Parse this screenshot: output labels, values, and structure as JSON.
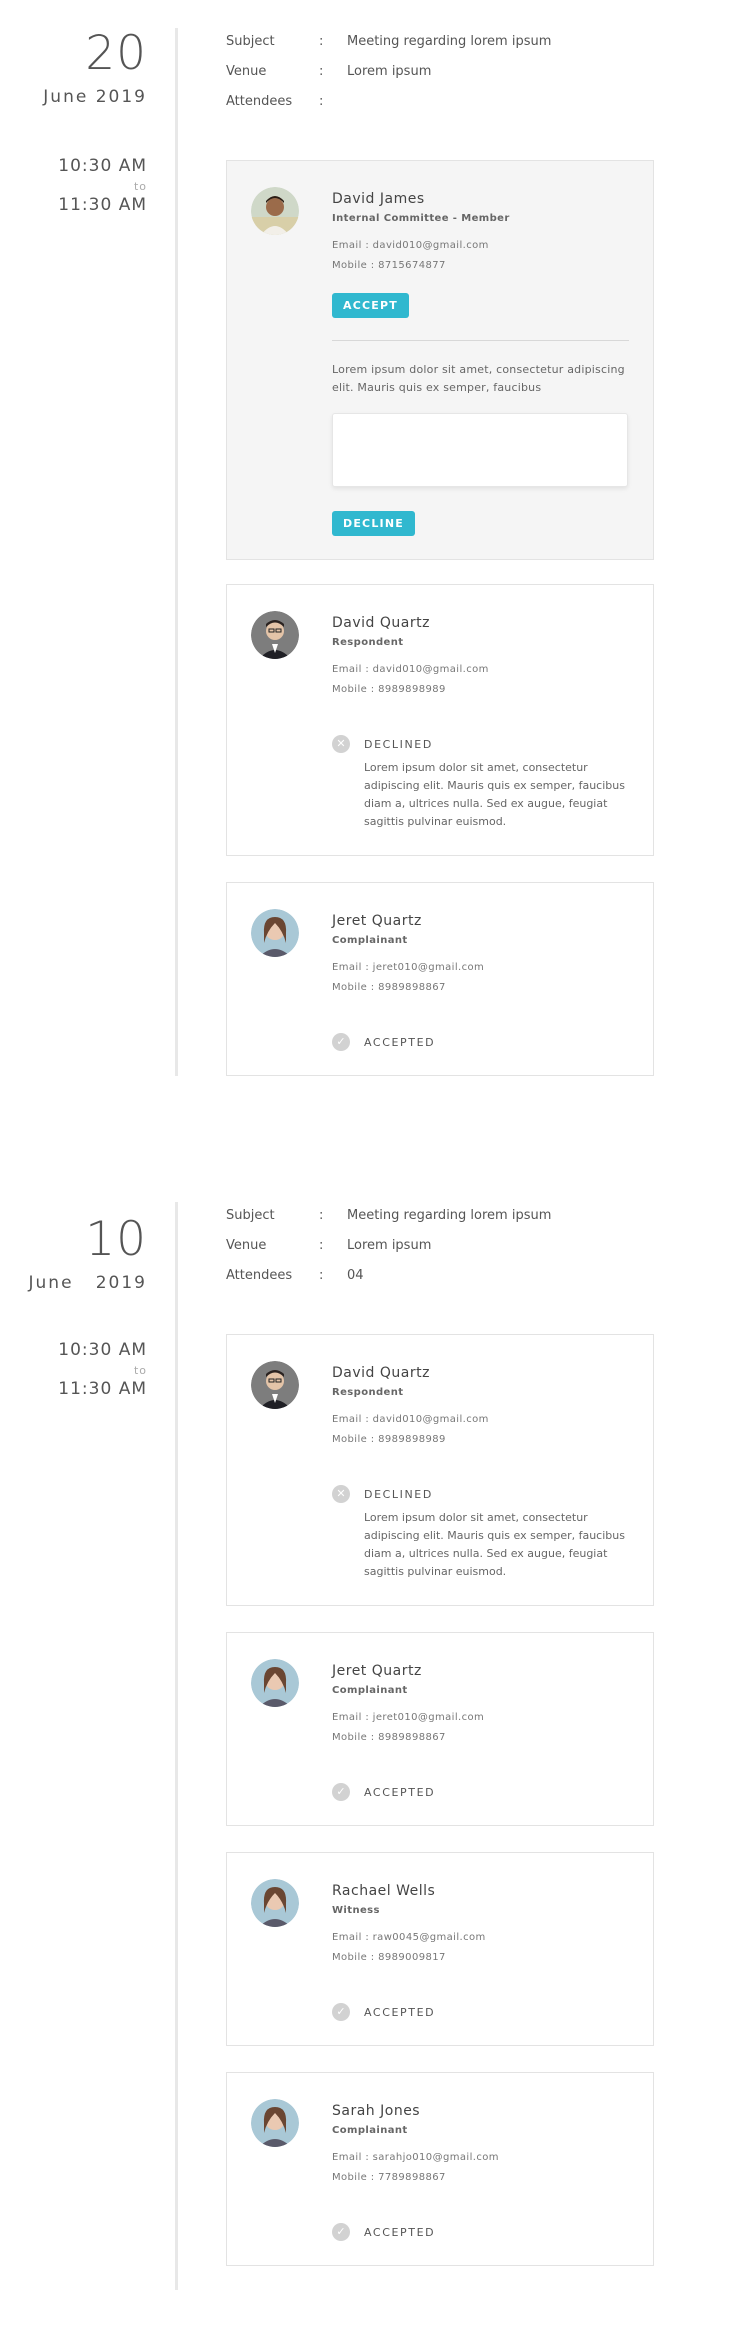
{
  "meetings": [
    {
      "day": "20",
      "month_year": "June 2019",
      "time_start": "10:30 AM",
      "time_to": "to",
      "time_end": "11:30 AM",
      "subject_label": "Subject",
      "subject_value": "Meeting regarding lorem ipsum",
      "venue_label": "Venue",
      "venue_value": "Lorem ipsum",
      "attendees_label": "Attendees",
      "attendees_value": "",
      "colon": ":",
      "attendees": [
        {
          "name": "David James",
          "role": "Internal Committee - Member",
          "email": "Email : david010@gmail.com",
          "mobile": "Mobile : 8715674877",
          "accept_label": "ACCEPT",
          "prompt": "Lorem ipsum dolor sit amet, consectetur adipiscing elit. Mauris quis ex semper, faucibus",
          "decline_label": "DECLINE"
        },
        {
          "name": "David Quartz",
          "role": "Respondent",
          "email": "Email : david010@gmail.com",
          "mobile": "Mobile : 8989898989",
          "status": "DECLINED",
          "status_icon": "close-icon",
          "note": "Lorem ipsum dolor sit amet, consectetur adipiscing elit. Mauris quis ex semper, faucibus diam a, ultrices nulla. Sed ex augue, feugiat sagittis pulvinar euismod."
        },
        {
          "name": "Jeret Quartz",
          "role": "Complainant",
          "email": "Email : jeret010@gmail.com",
          "mobile": "Mobile : 8989898867",
          "status": "ACCEPTED",
          "status_icon": "check-icon"
        }
      ]
    },
    {
      "day": "10",
      "month_year": "June   2019",
      "time_start": "10:30 AM",
      "time_to": "to",
      "time_end": "11:30 AM",
      "subject_label": "Subject",
      "subject_value": "Meeting regarding lorem ipsum",
      "venue_label": "Venue",
      "venue_value": "Lorem ipsum",
      "attendees_label": "Attendees",
      "attendees_value": "04",
      "colon": ":",
      "attendees": [
        {
          "name": "David Quartz",
          "role": "Respondent",
          "email": "Email : david010@gmail.com",
          "mobile": "Mobile : 8989898989",
          "status": "DECLINED",
          "status_icon": "close-icon",
          "note": "Lorem ipsum dolor sit amet, consectetur adipiscing elit. Mauris quis ex semper, faucibus diam a, ultrices nulla. Sed ex augue, feugiat sagittis pulvinar euismod."
        },
        {
          "name": "Jeret Quartz",
          "role": "Complainant",
          "email": "Email : jeret010@gmail.com",
          "mobile": "Mobile : 8989898867",
          "status": "ACCEPTED",
          "status_icon": "check-icon"
        },
        {
          "name": "Rachael Wells",
          "role": "Witness",
          "email": "Email : raw0045@gmail.com",
          "mobile": "Mobile : 8989009817",
          "status": "ACCEPTED",
          "status_icon": "check-icon"
        },
        {
          "name": "Sarah Jones",
          "role": "Complainant",
          "email": "Email : sarahjo010@gmail.com",
          "mobile": "Mobile : 7789898867",
          "status": "ACCEPTED",
          "status_icon": "check-icon"
        }
      ]
    }
  ],
  "colors": {
    "accent": "#30b8cf",
    "card_active_bg": "#f5f5f5",
    "border": "#e3e3e3",
    "status_icon_bg": "#d2d2d2"
  }
}
